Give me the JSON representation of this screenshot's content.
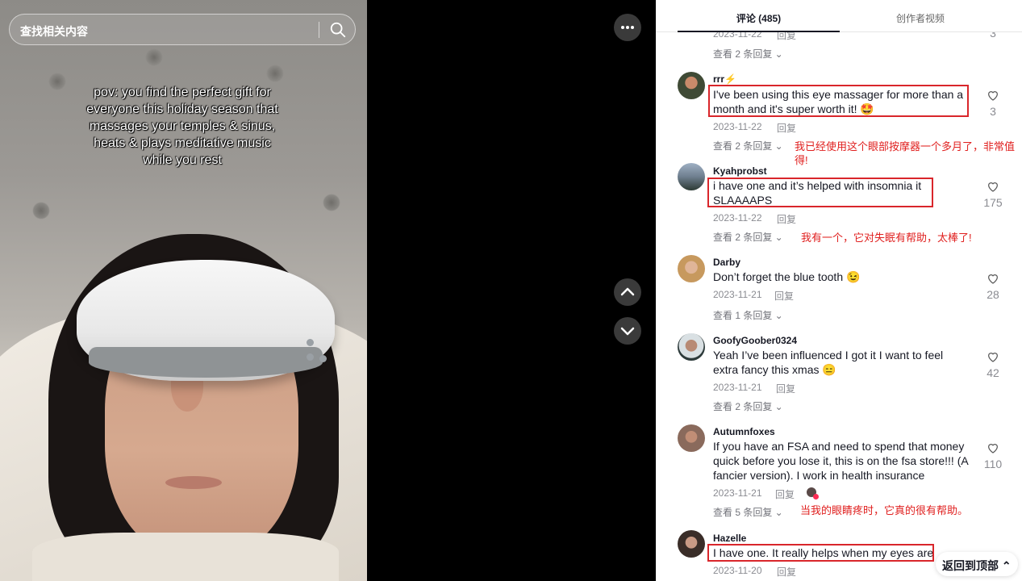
{
  "search": {
    "placeholder": "查找相关内容",
    "icon": "search-icon"
  },
  "video": {
    "caption": "pov: you find the perfect gift for everyone this holiday season that massages your temples & sinus, heats & plays meditative music while you rest"
  },
  "tabs": [
    {
      "label": "评论 (485)",
      "active": true
    },
    {
      "label": "创作者视频",
      "active": false
    }
  ],
  "top_partial": {
    "date": "2023-11-22",
    "reply": "回复",
    "likes": "3",
    "view_replies": "查看 2 条回复"
  },
  "comments": [
    {
      "username": "rrr⚡",
      "text": "I've been using this eye massager for more than a month and it's super worth it! 🤩",
      "date": "2023-11-22",
      "reply": "回复",
      "likes": "3",
      "view_replies": "查看 2 条回复",
      "translation": "我已经使用这个眼部按摩器一个多月了，非常值得!",
      "highlighted": true
    },
    {
      "username": "Kyahprobst",
      "text": "i have one and it’s helped with insomnia it SLAAAAPS",
      "date": "2023-11-22",
      "reply": "回复",
      "likes": "175",
      "view_replies": "查看 2 条回复",
      "translation": "我有一个，它对失眠有帮助，太棒了!",
      "highlighted": true
    },
    {
      "username": "Darby",
      "text": "Don’t forget the blue tooth 😉",
      "date": "2023-11-21",
      "reply": "回复",
      "likes": "28",
      "view_replies": "查看 1 条回复",
      "translation": "",
      "highlighted": false
    },
    {
      "username": "GoofyGoober0324",
      "text": "Yeah I’ve been influenced I got it I want to feel extra fancy this xmas 😑",
      "date": "2023-11-21",
      "reply": "回复",
      "likes": "42",
      "view_replies": "查看 2 条回复",
      "translation": "",
      "highlighted": false
    },
    {
      "username": "Autumnfoxes",
      "text": "If you have an FSA and need to spend that money quick before you lose it, this is on the fsa store!!! (A fancier version). I work in health insurance",
      "date": "2023-11-21",
      "reply": "回复",
      "likes": "110",
      "view_replies": "查看 5 条回复",
      "translation": "当我的眼睛疼时，它真的很有帮助。",
      "highlighted": false
    },
    {
      "username": "Hazelle",
      "text": "I have one. It really helps when my eyes are",
      "date": "2023-11-20",
      "reply": "回复",
      "likes": "",
      "view_replies": "",
      "translation": "",
      "highlighted": true
    }
  ],
  "back_to_top": "返回到顶部 ⌃",
  "colors": {
    "highlight": "#d9262b",
    "translation": "#e0201f"
  }
}
